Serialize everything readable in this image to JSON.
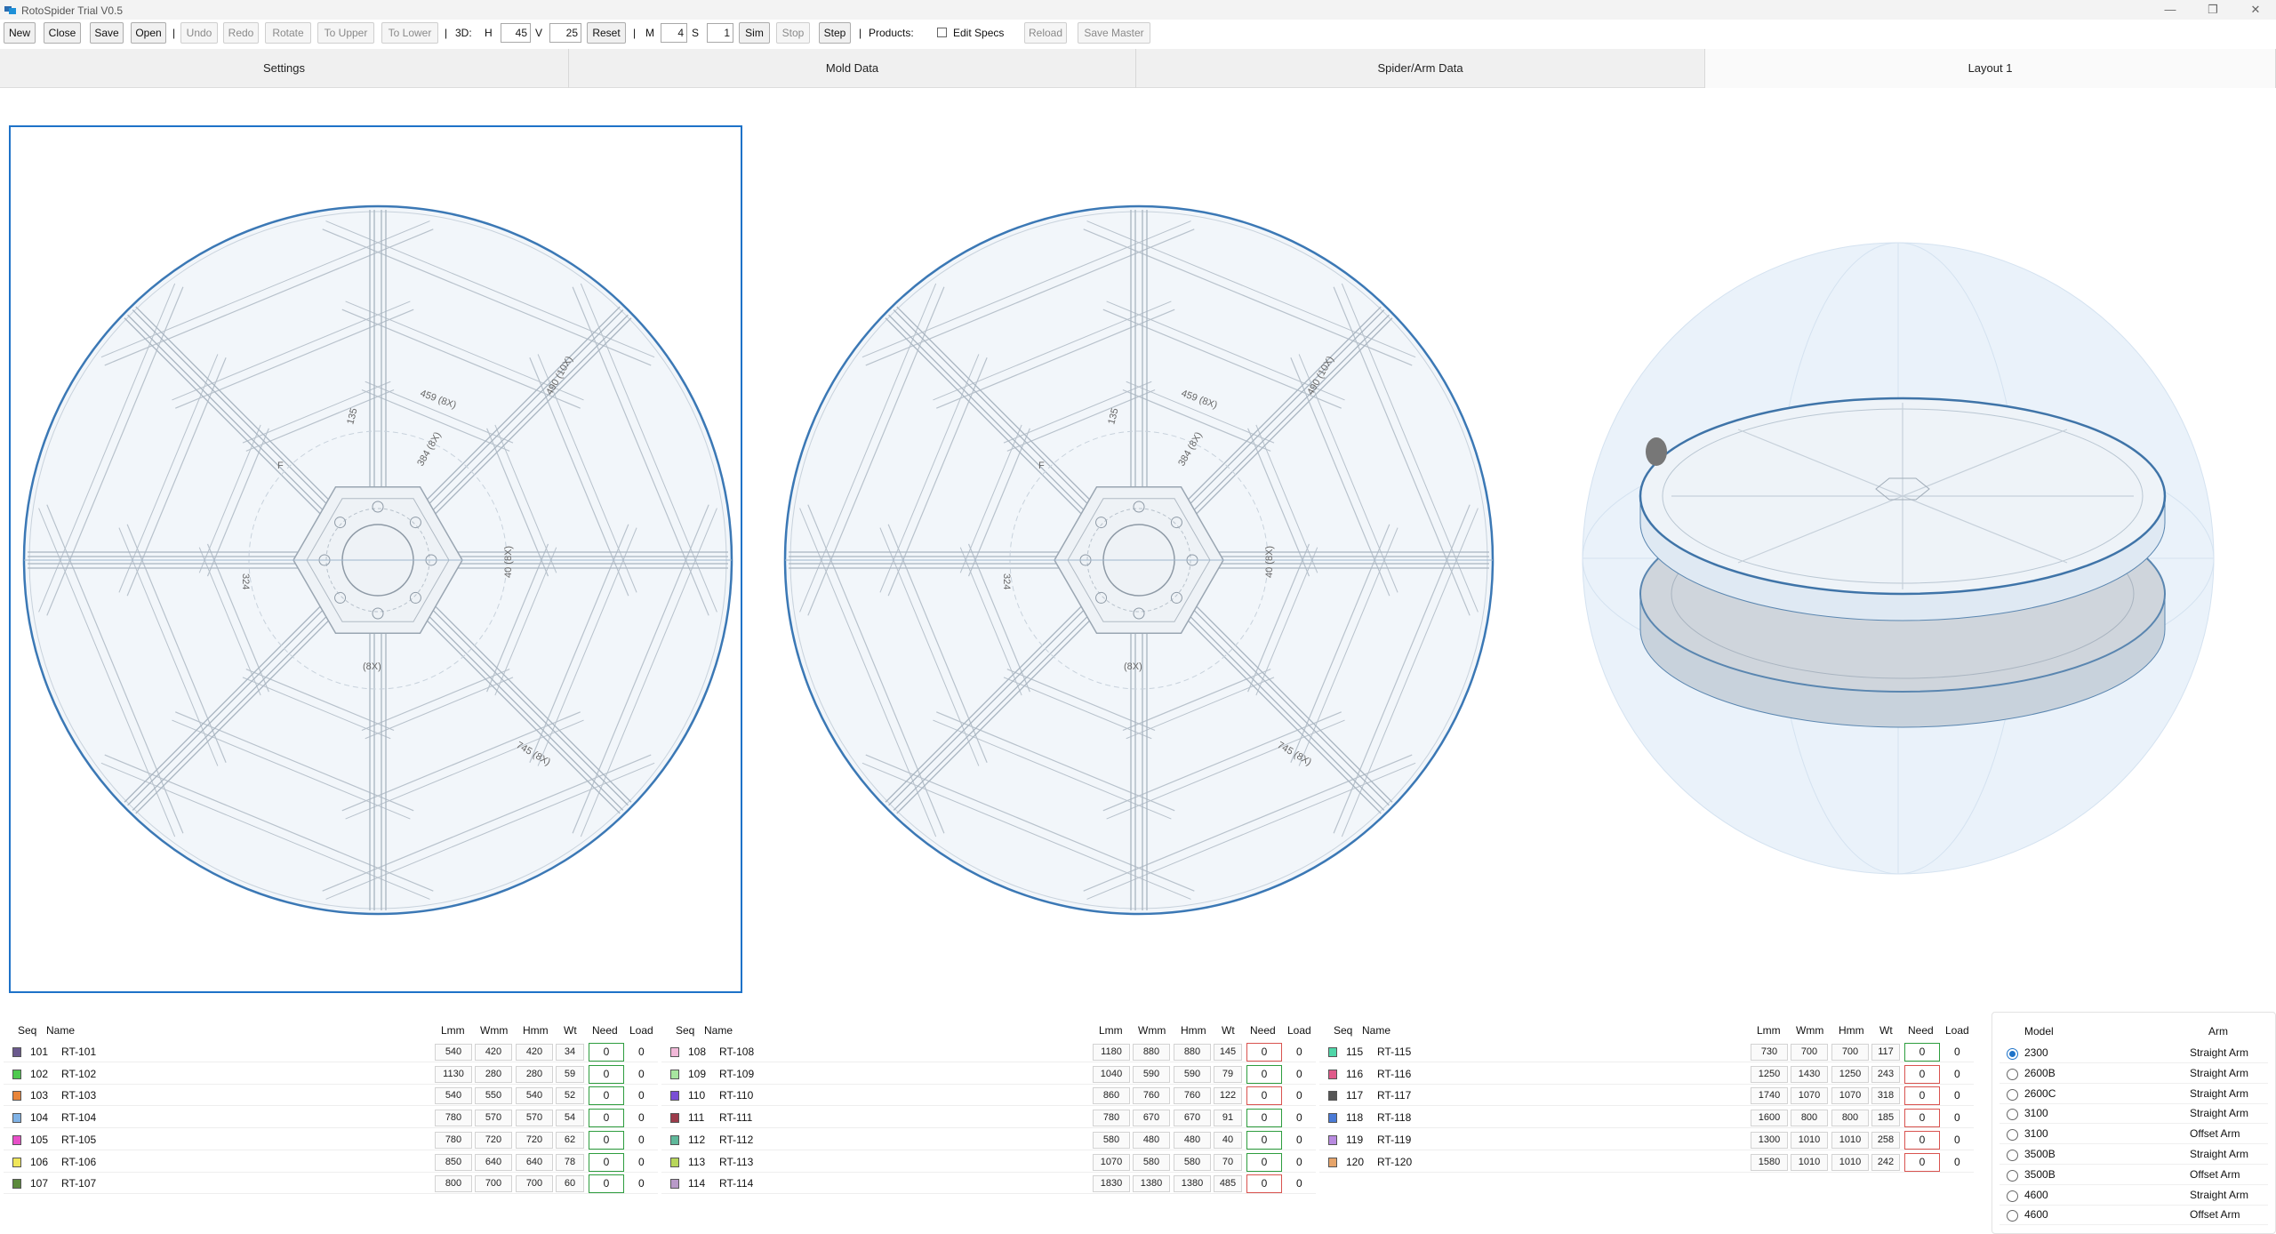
{
  "app": {
    "title": "RotoSpider Trial V0.5"
  },
  "toolbar": {
    "new": "New",
    "close": "Close",
    "save": "Save",
    "open": "Open",
    "undo": "Undo",
    "redo": "Redo",
    "rotate": "Rotate",
    "to_upper": "To Upper",
    "to_lower": "To Lower",
    "sep": "|",
    "three_d": "3D:",
    "h_label": "H",
    "h_value": "45",
    "v_label": "V",
    "v_value": "25",
    "reset": "Reset",
    "m_label": "M",
    "m_value": "4",
    "s_label": "S",
    "s_value": "1",
    "sim": "Sim",
    "stop": "Stop",
    "step": "Step",
    "products": "Products:",
    "edit_specs": "Edit Specs",
    "reload": "Reload",
    "save_master": "Save Master"
  },
  "tabs": [
    "Settings",
    "Mold Data",
    "Spider/Arm Data",
    "Layout 1"
  ],
  "drawing_labels": {
    "dim_a": "490 (10X)",
    "dim_b": "384 (8X)",
    "dim_c": "459 (8X)",
    "dim_d": "40 (8X)",
    "dim_e": "745 (8X)",
    "dim_f": "324",
    "dim_g": "(8X)",
    "dim_h": "135",
    "dim_i": "F"
  },
  "products_headers": {
    "seq": "Seq",
    "name": "Name",
    "l": "Lmm",
    "w": "Wmm",
    "h": "Hmm",
    "wt": "Wt",
    "need": "Need",
    "load": "Load"
  },
  "products": [
    [
      {
        "seq": "101",
        "name": "RT-101",
        "l": "540",
        "w": "420",
        "h": "420",
        "wt": "34",
        "need": "0",
        "load": "0",
        "color": "#6b5a8e",
        "status": "green"
      },
      {
        "seq": "102",
        "name": "RT-102",
        "l": "1130",
        "w": "280",
        "h": "280",
        "wt": "59",
        "need": "0",
        "load": "0",
        "color": "#4ec94e",
        "status": "green"
      },
      {
        "seq": "103",
        "name": "RT-103",
        "l": "540",
        "w": "550",
        "h": "540",
        "wt": "52",
        "need": "0",
        "load": "0",
        "color": "#e8853a",
        "status": "green"
      },
      {
        "seq": "104",
        "name": "RT-104",
        "l": "780",
        "w": "570",
        "h": "570",
        "wt": "54",
        "need": "0",
        "load": "0",
        "color": "#7fb2e6",
        "status": "green"
      },
      {
        "seq": "105",
        "name": "RT-105",
        "l": "780",
        "w": "720",
        "h": "720",
        "wt": "62",
        "need": "0",
        "load": "0",
        "color": "#e84fc8",
        "status": "green"
      },
      {
        "seq": "106",
        "name": "RT-106",
        "l": "850",
        "w": "640",
        "h": "640",
        "wt": "78",
        "need": "0",
        "load": "0",
        "color": "#f0e65a",
        "status": "green"
      },
      {
        "seq": "107",
        "name": "RT-107",
        "l": "800",
        "w": "700",
        "h": "700",
        "wt": "60",
        "need": "0",
        "load": "0",
        "color": "#5c8a3c",
        "status": "green"
      }
    ],
    [
      {
        "seq": "108",
        "name": "RT-108",
        "l": "1180",
        "w": "880",
        "h": "880",
        "wt": "145",
        "need": "0",
        "load": "0",
        "color": "#f2b8d8",
        "status": "red"
      },
      {
        "seq": "109",
        "name": "RT-109",
        "l": "1040",
        "w": "590",
        "h": "590",
        "wt": "79",
        "need": "0",
        "load": "0",
        "color": "#a8e6a0",
        "status": "green"
      },
      {
        "seq": "110",
        "name": "RT-110",
        "l": "860",
        "w": "760",
        "h": "760",
        "wt": "122",
        "need": "0",
        "load": "0",
        "color": "#7a4fd6",
        "status": "red"
      },
      {
        "seq": "111",
        "name": "RT-111",
        "l": "780",
        "w": "670",
        "h": "670",
        "wt": "91",
        "need": "0",
        "load": "0",
        "color": "#9c3b4a",
        "status": "green"
      },
      {
        "seq": "112",
        "name": "RT-112",
        "l": "580",
        "w": "480",
        "h": "480",
        "wt": "40",
        "need": "0",
        "load": "0",
        "color": "#5fb89a",
        "status": "green"
      },
      {
        "seq": "113",
        "name": "RT-113",
        "l": "1070",
        "w": "580",
        "h": "580",
        "wt": "70",
        "need": "0",
        "load": "0",
        "color": "#b8d65a",
        "status": "green"
      },
      {
        "seq": "114",
        "name": "RT-114",
        "l": "1830",
        "w": "1380",
        "h": "1380",
        "wt": "485",
        "need": "0",
        "load": "0",
        "color": "#b89ac8",
        "status": "red"
      }
    ],
    [
      {
        "seq": "115",
        "name": "RT-115",
        "l": "730",
        "w": "700",
        "h": "700",
        "wt": "117",
        "need": "0",
        "load": "0",
        "color": "#4fd6a8",
        "status": "green"
      },
      {
        "seq": "116",
        "name": "RT-116",
        "l": "1250",
        "w": "1430",
        "h": "1250",
        "wt": "243",
        "need": "0",
        "load": "0",
        "color": "#e05a8a",
        "status": "red"
      },
      {
        "seq": "117",
        "name": "RT-117",
        "l": "1740",
        "w": "1070",
        "h": "1070",
        "wt": "318",
        "need": "0",
        "load": "0",
        "color": "#555555",
        "status": "red"
      },
      {
        "seq": "118",
        "name": "RT-118",
        "l": "1600",
        "w": "800",
        "h": "800",
        "wt": "185",
        "need": "0",
        "load": "0",
        "color": "#4a7ad6",
        "status": "red"
      },
      {
        "seq": "119",
        "name": "RT-119",
        "l": "1300",
        "w": "1010",
        "h": "1010",
        "wt": "258",
        "need": "0",
        "load": "0",
        "color": "#b88ae0",
        "status": "red"
      },
      {
        "seq": "120",
        "name": "RT-120",
        "l": "1580",
        "w": "1010",
        "h": "1010",
        "wt": "242",
        "need": "0",
        "load": "0",
        "color": "#e6a46a",
        "status": "red"
      }
    ]
  ],
  "models_headers": {
    "model": "Model",
    "arm": "Arm"
  },
  "models": [
    {
      "model": "2300",
      "arm": "Straight Arm",
      "selected": true
    },
    {
      "model": "2600B",
      "arm": "Straight Arm",
      "selected": false
    },
    {
      "model": "2600C",
      "arm": "Straight Arm",
      "selected": false
    },
    {
      "model": "3100",
      "arm": "Straight Arm",
      "selected": false
    },
    {
      "model": "3100",
      "arm": "Offset Arm",
      "selected": false
    },
    {
      "model": "3500B",
      "arm": "Straight Arm",
      "selected": false
    },
    {
      "model": "3500B",
      "arm": "Offset Arm",
      "selected": false
    },
    {
      "model": "4600",
      "arm": "Straight Arm",
      "selected": false
    },
    {
      "model": "4600",
      "arm": "Offset Arm",
      "selected": false
    }
  ],
  "colors": {
    "accent": "#1e72c8",
    "need_ok": "#2e9d3e",
    "need_bad": "#d9534f",
    "drawing": "#d4dae2",
    "drawing_fill": "#f2f6fa"
  }
}
